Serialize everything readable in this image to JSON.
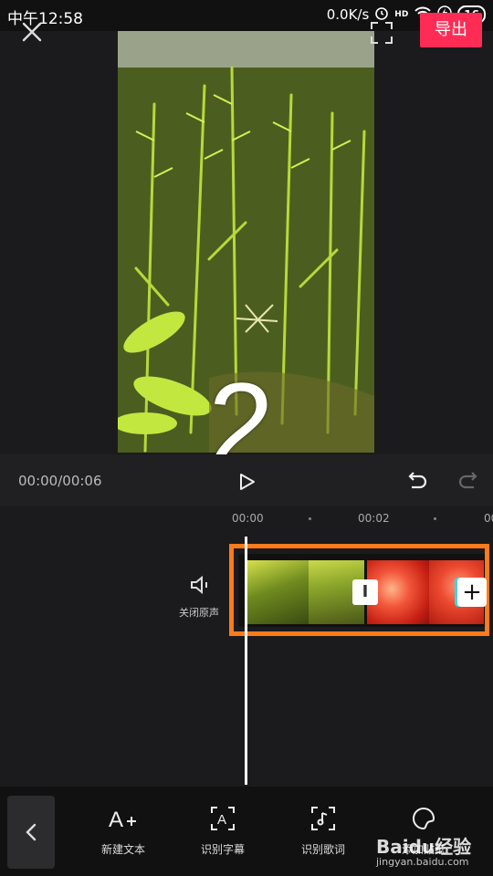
{
  "status_bar": {
    "time": "中午12:58",
    "speed": "0.0K/s",
    "network": "HD",
    "battery": "16"
  },
  "toolbar": {
    "close_icon": "close-icon",
    "fullscreen_icon": "fullscreen-icon",
    "export_label": "导出"
  },
  "preview": {
    "overlay_number": "2"
  },
  "playback": {
    "timecode": "00:00/00:06",
    "play_icon": "play-icon",
    "undo_icon": "undo-icon",
    "redo_icon": "redo-icon"
  },
  "ruler": {
    "ticks": [
      "00:00",
      "00:02",
      "00"
    ]
  },
  "timeline": {
    "mute_label": "关闭原声",
    "transition_label": "I",
    "add_label": "+"
  },
  "bottom_toolbar": {
    "tools": [
      {
        "label": "新建文本",
        "icon": "add-text-icon"
      },
      {
        "label": "识别字幕",
        "icon": "recognize-subtitle-icon"
      },
      {
        "label": "识别歌词",
        "icon": "recognize-lyrics-icon"
      },
      {
        "label": "添加贴纸",
        "icon": "sticker-icon"
      }
    ]
  },
  "watermark": {
    "text": "Baidu经验",
    "url": "jingyan.baidu.com"
  },
  "colors": {
    "accent": "#fe2c55",
    "highlight": "#ff7a1a",
    "background": "#1b1b1d"
  }
}
